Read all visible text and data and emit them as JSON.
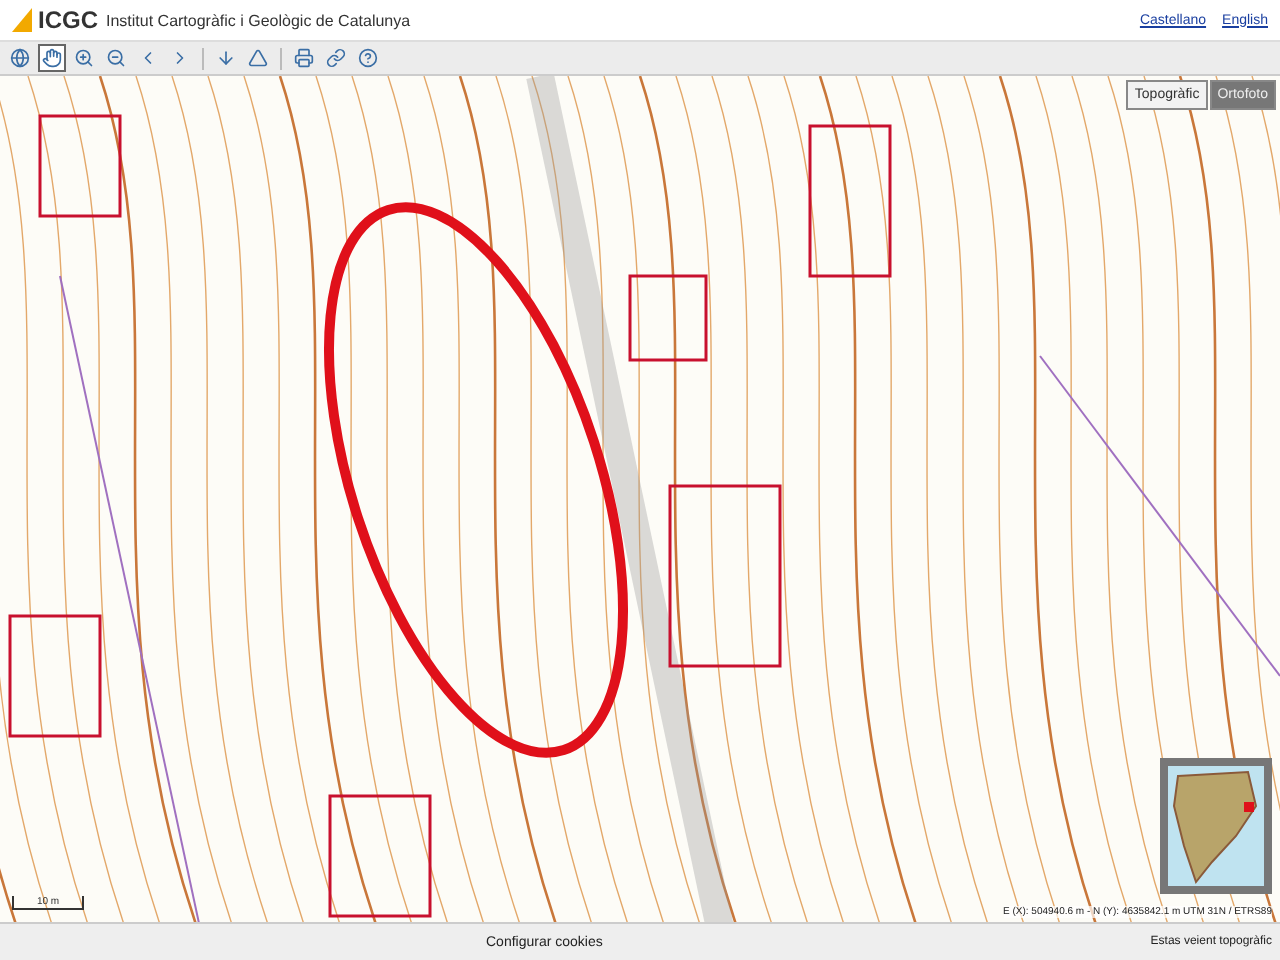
{
  "header": {
    "logo": "ICGC",
    "title": "Institut Cartogràfic i Geològic de Catalunya",
    "languages": [
      "Castellano",
      "English"
    ]
  },
  "toolbar": [
    {
      "kind": "globe",
      "selected": false
    },
    {
      "kind": "hand",
      "selected": true
    },
    {
      "kind": "zoom_in",
      "selected": false
    },
    {
      "kind": "zoom_out",
      "selected": false
    },
    {
      "kind": "back",
      "selected": false
    },
    {
      "kind": "forward",
      "selected": false
    },
    {
      "kind": "separator"
    },
    {
      "kind": "download",
      "selected": false
    },
    {
      "kind": "measure",
      "selected": false
    },
    {
      "kind": "separator"
    },
    {
      "kind": "print",
      "selected": false
    },
    {
      "kind": "link",
      "selected": false
    },
    {
      "kind": "help",
      "selected": false
    }
  ],
  "map": {
    "layers": [
      {
        "label": "Topogràfic",
        "selected": true
      },
      {
        "label": "Ortofoto",
        "selected": false
      }
    ],
    "scale": "10 m",
    "coordinates": "E (X): 504940.6 m - N (Y): 4635842.1 m UTM 31N / ETRS89"
  },
  "footer": {
    "cookies": "Configurar cookies",
    "status": "Estas veient topogràfic"
  }
}
